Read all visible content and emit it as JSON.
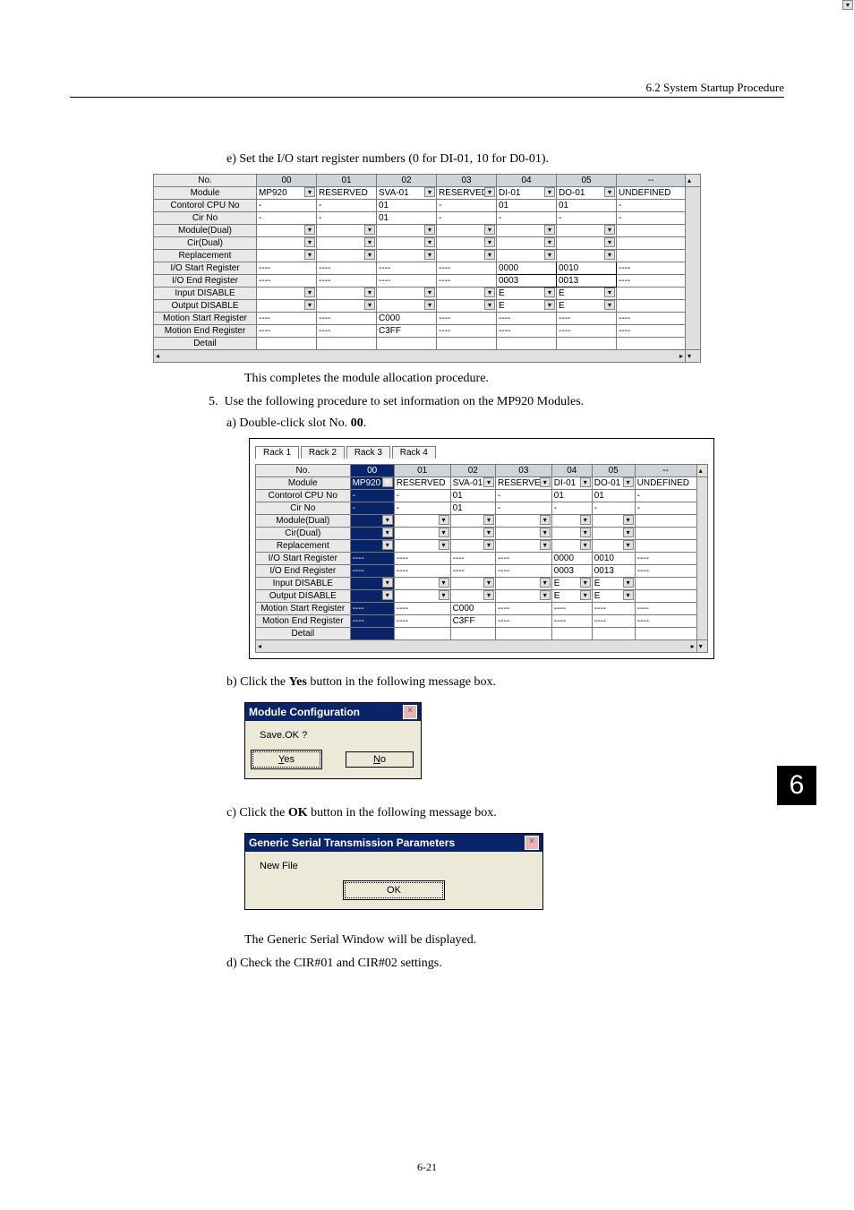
{
  "header": {
    "section": "6.2  System Startup Procedure"
  },
  "chapter_box": "6",
  "page_number": "6-21",
  "step_e": {
    "text_prefix": "e) ",
    "text": "Set the I/O start register numbers (0 for DI-01, 10 for D0-01).",
    "completes": "This completes the module allocation procedure."
  },
  "step5": {
    "num": "5.",
    "text": "Use the following procedure to set information on the MP920 Modules.",
    "a_prefix": "a) Double-click slot No.",
    "a_bold": " 00",
    "a_suffix": "."
  },
  "step_b": {
    "prefix": "b) Click the ",
    "bold": "Yes",
    "suffix": " button in the following message box."
  },
  "step_c": {
    "prefix": "c) Click the ",
    "bold": "OK",
    "suffix": " button in the following message box."
  },
  "step_c_result": "The Generic Serial Window will be displayed.",
  "step_d": "d) Check the CIR#01 and CIR#02 settings.",
  "grid_headers": [
    "No.",
    "00",
    "01",
    "02",
    "03",
    "04",
    "05",
    "--"
  ],
  "row_labels": [
    "Module",
    "Contorol CPU No",
    "Cir No",
    "Module(Dual)",
    "Cir(Dual)",
    "Replacement",
    "I/O Start Register",
    "I/O End Register",
    "Input DISABLE",
    "Output DISABLE",
    "Motion Start Register",
    "Motion End Register",
    "Detail"
  ],
  "grid1": {
    "rows": {
      "Module": [
        "MP920",
        "RESERVED",
        "SVA-01",
        "RESERVED",
        "DI-01",
        "DO-01",
        "UNDEFINED"
      ],
      "Contorol CPU No": [
        "-",
        "-",
        "01",
        "-",
        "01",
        "01",
        "-"
      ],
      "Cir No": [
        "-",
        "-",
        "01",
        "-",
        "-",
        "-",
        "-"
      ],
      "Module(Dual)": [
        "",
        "",
        "",
        "",
        "",
        "",
        ""
      ],
      "Cir(Dual)": [
        "",
        "",
        "",
        "",
        "",
        "",
        ""
      ],
      "Replacement": [
        "",
        "",
        "",
        "",
        "",
        "",
        ""
      ],
      "I/O Start Register": [
        "----",
        "----",
        "----",
        "----",
        "0000",
        "0010",
        "----"
      ],
      "I/O End Register": [
        "----",
        "----",
        "----",
        "----",
        "0003",
        "0013",
        "----"
      ],
      "Input DISABLE": [
        "",
        "",
        "",
        "",
        "E",
        "E",
        ""
      ],
      "Output DISABLE": [
        "",
        "",
        "",
        "",
        "E",
        "E",
        ""
      ],
      "Motion Start Register": [
        "----",
        "----",
        "C000",
        "----",
        "----",
        "----",
        "----"
      ],
      "Motion End Register": [
        "----",
        "----",
        "C3FF",
        "----",
        "----",
        "----",
        "----"
      ],
      "Detail": [
        "",
        "",
        "",
        "",
        "",
        "",
        ""
      ]
    }
  },
  "rack_tabs": [
    "Rack 1",
    "Rack 2",
    "Rack 3",
    "Rack 4"
  ],
  "grid2": {
    "rows": {
      "Module": [
        "MP920",
        "RESERVED",
        "SVA-01",
        "RESERVED",
        "DI-01",
        "DO-01",
        "UNDEFINED"
      ],
      "Contorol CPU No": [
        "-",
        "-",
        "01",
        "-",
        "01",
        "01",
        "-"
      ],
      "Cir No": [
        "-",
        "-",
        "01",
        "-",
        "-",
        "-",
        "-"
      ],
      "Module(Dual)": [
        "",
        "",
        "",
        "",
        "",
        "",
        ""
      ],
      "Cir(Dual)": [
        "",
        "",
        "",
        "",
        "",
        "",
        ""
      ],
      "Replacement": [
        "",
        "",
        "",
        "",
        "",
        "",
        ""
      ],
      "I/O Start Register": [
        "----",
        "----",
        "----",
        "----",
        "0000",
        "0010",
        "----"
      ],
      "I/O End Register": [
        "----",
        "----",
        "----",
        "----",
        "0003",
        "0013",
        "----"
      ],
      "Input DISABLE": [
        "",
        "",
        "",
        "",
        "E",
        "E",
        ""
      ],
      "Output DISABLE": [
        "",
        "",
        "",
        "",
        "E",
        "E",
        ""
      ],
      "Motion Start Register": [
        "----",
        "----",
        "C000",
        "----",
        "----",
        "----",
        "----"
      ],
      "Motion End Register": [
        "----",
        "----",
        "C3FF",
        "----",
        "----",
        "----",
        "----"
      ],
      "Detail": [
        "",
        "",
        "",
        "",
        "",
        "",
        ""
      ]
    }
  },
  "dlg1": {
    "title": "Module Configuration",
    "body": "Save.OK ?",
    "yes": "Yes",
    "no": "No"
  },
  "dlg2": {
    "title": "Generic Serial Transmission Parameters",
    "body": "New File",
    "ok": "OK"
  }
}
